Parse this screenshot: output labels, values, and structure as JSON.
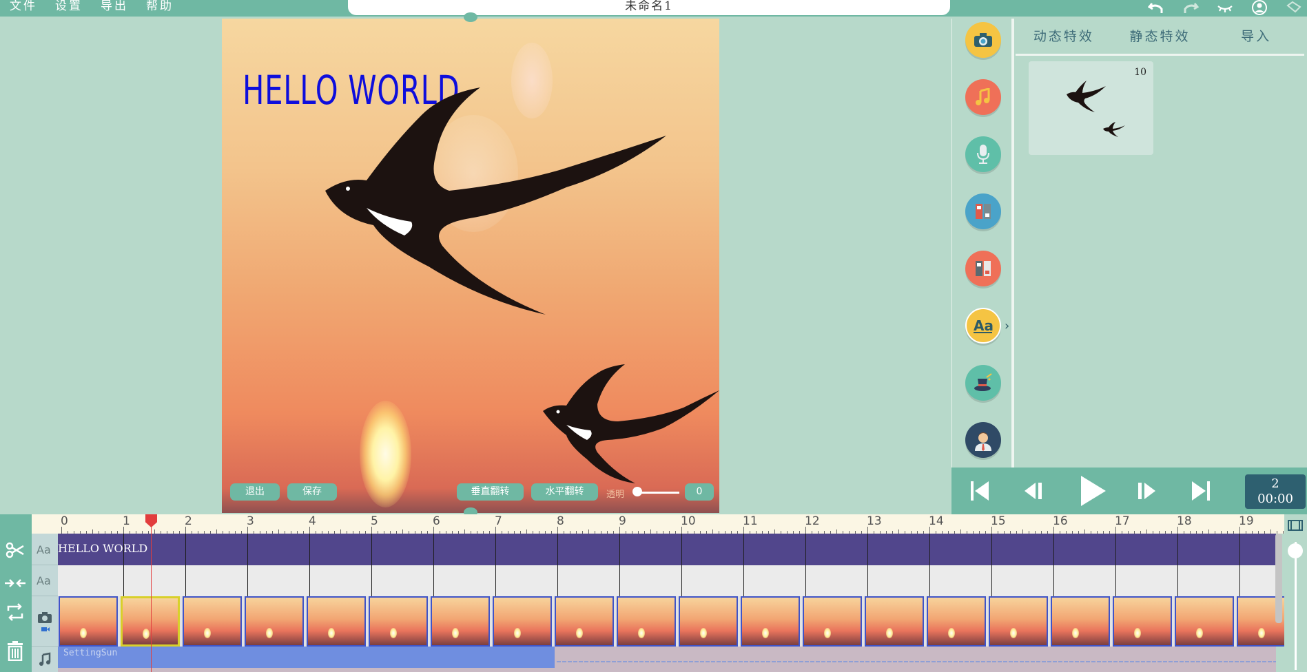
{
  "menu": {
    "file": "文件",
    "settings": "设置",
    "export": "导出",
    "help": "帮助"
  },
  "project_title": "未命名1",
  "top_icons": [
    "undo-icon",
    "redo-icon",
    "eye-closed-icon",
    "user-icon",
    "fullscreen-icon"
  ],
  "preview": {
    "overlay_text": "HELLO WORLD",
    "exit_label": "退出",
    "save_label": "保存",
    "vflip_label": "垂直翻转",
    "hflip_label": "水平翻转",
    "opacity_label": "透明",
    "opacity_value": "0",
    "colors": {
      "overlay_text": "#0e0edc",
      "button": "#6fb8a3"
    }
  },
  "tools": [
    "camera-icon",
    "music-icon",
    "microphone-icon",
    "transition-icon",
    "filter-icon",
    "text-icon",
    "magic-hat-icon",
    "character-icon"
  ],
  "effects": {
    "tabs": [
      "动态特效",
      "静态特效",
      "导入"
    ],
    "item_count": "10"
  },
  "player": {
    "frame": "2",
    "time": "00:00"
  },
  "timeline": {
    "ticks": [
      "0",
      "1",
      "2",
      "3",
      "4",
      "5",
      "6",
      "7",
      "8",
      "9",
      "10",
      "11",
      "12",
      "13",
      "14",
      "15",
      "16",
      "17",
      "18",
      "19"
    ],
    "text_track_label": "HELLO WORLD",
    "audio_clip_label": "SettingSun",
    "track_icons": [
      "text-track-icon",
      "text-track-icon",
      "video-track-icon",
      "audio-track-icon"
    ],
    "side_tools": [
      "scissors-icon",
      "merge-icon",
      "replace-icon",
      "delete-icon"
    ],
    "frame_count": 20,
    "selected_frame": 1
  },
  "accent": "#6fb8a3",
  "background": "#b7d9ca"
}
